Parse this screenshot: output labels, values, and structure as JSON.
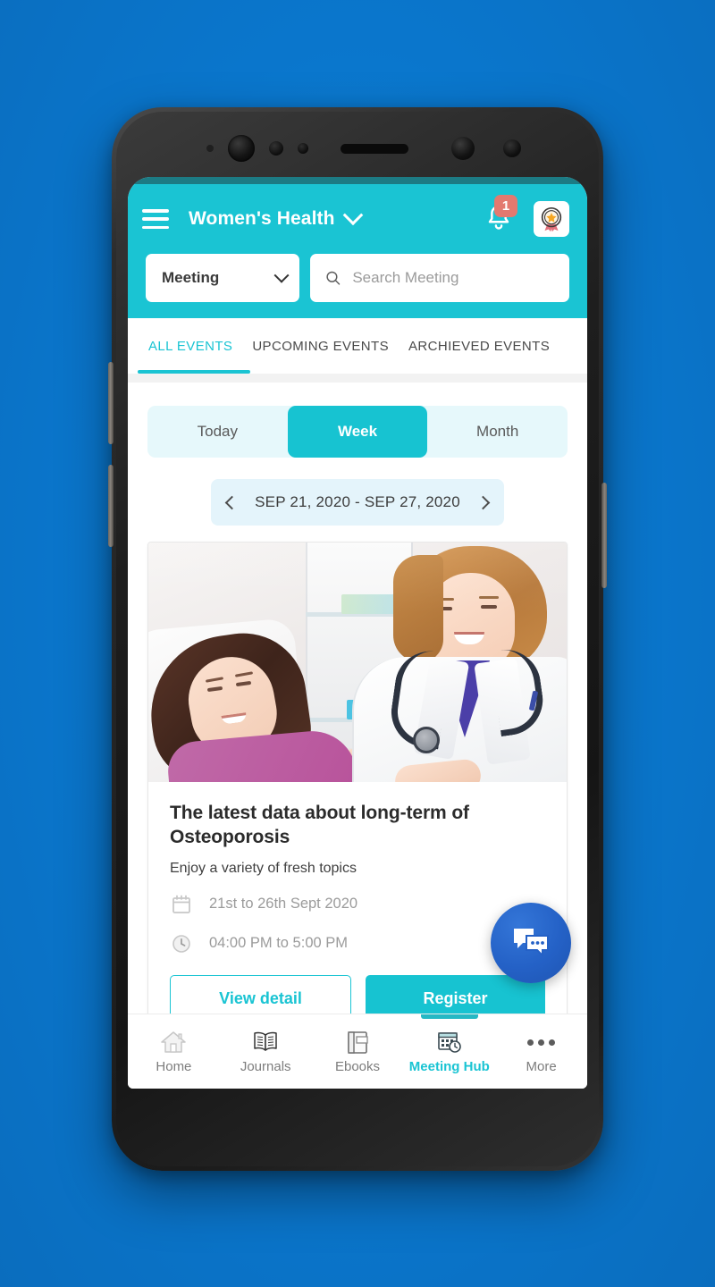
{
  "theme": {
    "background": "#0B7AD0",
    "accent_teal": "#1AC4D3",
    "accent_teal_dark": "#17C3D1",
    "badge_red": "#E3796F",
    "fab_blue": "#2461C6",
    "segment_bg": "#E6F8FB",
    "daterange_bg": "#E4F4FB"
  },
  "header": {
    "menu_icon": "hamburger-icon",
    "title": "Women's Health",
    "title_chevron_icon": "chevron-down-icon",
    "notification_icon": "bell-icon",
    "notification_count": "1",
    "award_icon": "award-badge-icon"
  },
  "search": {
    "category_label": "Meeting",
    "category_chevron_icon": "chevron-down-icon",
    "search_icon": "search-icon",
    "placeholder": "Search Meeting",
    "value": ""
  },
  "tabs": [
    {
      "label": "ALL EVENTS",
      "active": true
    },
    {
      "label": "UPCOMING EVENTS",
      "active": false
    },
    {
      "label": "ARCHIEVED EVENTS",
      "active": false
    }
  ],
  "segment": [
    {
      "label": "Today",
      "active": false
    },
    {
      "label": "Week",
      "active": true
    },
    {
      "label": "Month",
      "active": false
    }
  ],
  "date_range": {
    "prev_icon": "chevron-left-icon",
    "text": "SEP 21, 2020 - SEP 27, 2020",
    "next_icon": "chevron-right-icon"
  },
  "event_card": {
    "image_alt": "doctor-examining-patient-photo",
    "title": "The latest data about long-term of Osteoporosis",
    "subtitle": "Enjoy a variety of fresh topics",
    "date_icon": "calendar-icon",
    "date_text": "21st to 26th Sept 2020",
    "time_icon": "clock-icon",
    "time_text": "04:00 PM to 5:00 PM",
    "view_detail_label": "View detail",
    "register_label": "Register"
  },
  "fab": {
    "icon": "chat-bubbles-icon",
    "label": "Chat"
  },
  "bottom_nav": [
    {
      "label": "Home",
      "icon": "home-icon",
      "active": false
    },
    {
      "label": "Journals",
      "icon": "open-book-icon",
      "active": false
    },
    {
      "label": "Ebooks",
      "icon": "ebook-icon",
      "active": false
    },
    {
      "label": "Meeting Hub",
      "icon": "calendar-clock-icon",
      "active": true
    },
    {
      "label": "More",
      "icon": "ellipsis-icon",
      "active": false
    }
  ]
}
